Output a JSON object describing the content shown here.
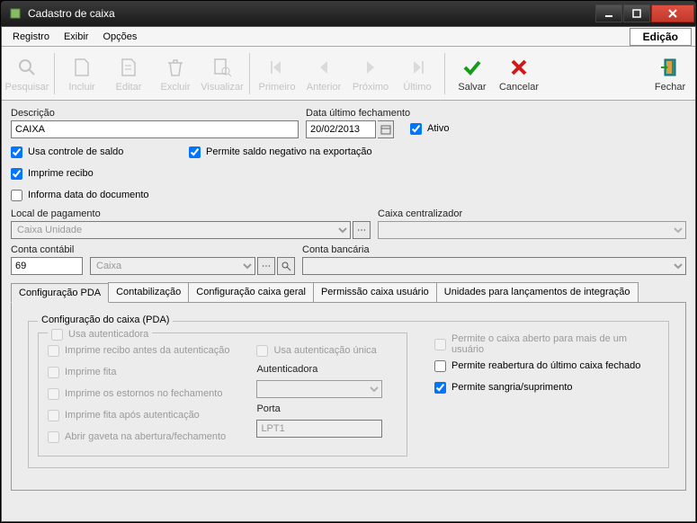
{
  "window": {
    "title": "Cadastro de caixa",
    "edicao": "Edição"
  },
  "menu": {
    "registro": "Registro",
    "exibir": "Exibir",
    "opcoes": "Opções"
  },
  "toolbar": {
    "pesquisar": "Pesquisar",
    "incluir": "Incluir",
    "editar": "Editar",
    "excluir": "Excluir",
    "visualizar": "Visualizar",
    "primeiro": "Primeiro",
    "anterior": "Anterior",
    "proximo": "Próximo",
    "ultimo": "Último",
    "salvar": "Salvar",
    "cancelar": "Cancelar",
    "fechar": "Fechar"
  },
  "form": {
    "descricao_label": "Descrição",
    "descricao_value": "CAIXA",
    "data_ult_label": "Data último fechamento",
    "data_ult_value": "20/02/2013",
    "ativo_label": "Ativo",
    "usa_controle_saldo": "Usa controle de saldo",
    "permite_saldo_neg": "Permite saldo negativo na exportação",
    "imprime_recibo": "Imprime recibo",
    "informa_data_doc": "Informa data do documento",
    "local_pag_label": "Local de  pagamento",
    "local_pag_value": "Caixa Unidade",
    "caixa_central_label": "Caixa centralizador",
    "caixa_central_value": "",
    "conta_contabil_label": "Conta contábil",
    "conta_contabil_num": "69",
    "conta_contabil_value": "Caixa",
    "conta_bancaria_label": "Conta bancária",
    "conta_bancaria_value": ""
  },
  "tabs": {
    "config_pda": "Configuração PDA",
    "contabilizacao": "Contabilização",
    "config_caixa_geral": "Configuração caixa geral",
    "permissao_caixa_usuario": "Permissão caixa usuário",
    "unidades_integracao": "Unidades para lançamentos de integração"
  },
  "pda": {
    "group_title": "Configuração do caixa (PDA)",
    "inner_group_title": "Usa autenticadora",
    "imprime_recibo_antes": "Imprime recibo antes da autenticação",
    "usa_aut_unica": "Usa autenticação única",
    "imprime_fita": "Imprime fita",
    "imprime_estornos": "Imprime os estornos no fechamento",
    "imprime_fita_apos": "Imprime fita após autenticação",
    "abrir_gaveta": "Abrir gaveta na abertura/fechamento",
    "autenticadora_label": "Autenticadora",
    "porta_label": "Porta",
    "porta_value": "LPT1",
    "permite_caixa_aberto": "Permite o caixa aberto para mais de um usuário",
    "permite_reabertura": "Permite reabertura do último caixa fechado",
    "permite_sangria": "Permite sangria/suprimento"
  },
  "colors": {
    "green": "#1a9a1a",
    "red": "#d01a1a"
  }
}
